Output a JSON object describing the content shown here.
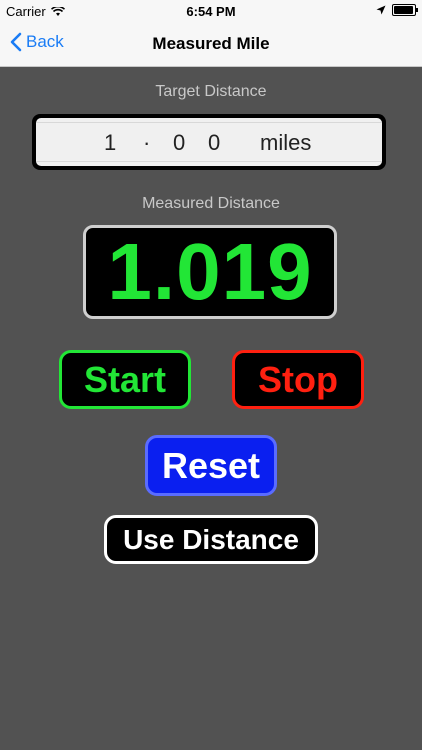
{
  "status": {
    "carrier": "Carrier",
    "time": "6:54 PM",
    "battery_level": 0.95
  },
  "nav": {
    "back_label": "Back",
    "title": "Measured Mile"
  },
  "target": {
    "label": "Target Distance",
    "digits": [
      "1",
      "·",
      "0",
      "0"
    ],
    "unit": "miles"
  },
  "measured": {
    "label": "Measured Distance",
    "value": "1.019"
  },
  "buttons": {
    "start": "Start",
    "stop": "Stop",
    "reset": "Reset",
    "use_distance": "Use Distance"
  },
  "colors": {
    "green": "#22e636",
    "red": "#ff2010",
    "blue": "#0a1ff0",
    "link": "#1a7cf5",
    "bg": "#525252"
  }
}
